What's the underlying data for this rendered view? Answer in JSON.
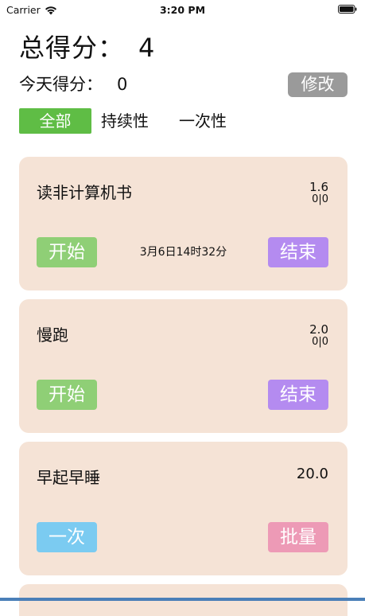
{
  "status_bar": {
    "carrier": "Carrier",
    "time": "3:20 PM"
  },
  "header": {
    "total_label": "总得分：",
    "total_value": "4",
    "today_label": "今天得分：",
    "today_value": "0",
    "edit_label": "修改"
  },
  "tabs": [
    {
      "label": "全部",
      "active": true
    },
    {
      "label": "持续性",
      "active": false
    },
    {
      "label": "一次性",
      "active": false
    }
  ],
  "tasks": [
    {
      "title": "读非计算机书",
      "score": "1.6",
      "score_sub": "0|0",
      "timestamp": "3月6日14时32分",
      "left_button": "开始",
      "right_button": "结束"
    },
    {
      "title": "慢跑",
      "score": "2.0",
      "score_sub": "0|0",
      "timestamp": "",
      "left_button": "开始",
      "right_button": "结束"
    },
    {
      "title": "早起早睡",
      "score": "20.0",
      "score_sub": "",
      "timestamp": "",
      "left_button": "一次",
      "right_button": "批量"
    }
  ],
  "colors": {
    "accent_green": "#5fbd45",
    "card_bg": "#f5e3d6",
    "start_green": "#8fcf76",
    "end_purple": "#b48bf0",
    "once_blue": "#7bcbf1",
    "batch_pink": "#ed9ab6",
    "edit_gray": "#9a9a9a"
  }
}
